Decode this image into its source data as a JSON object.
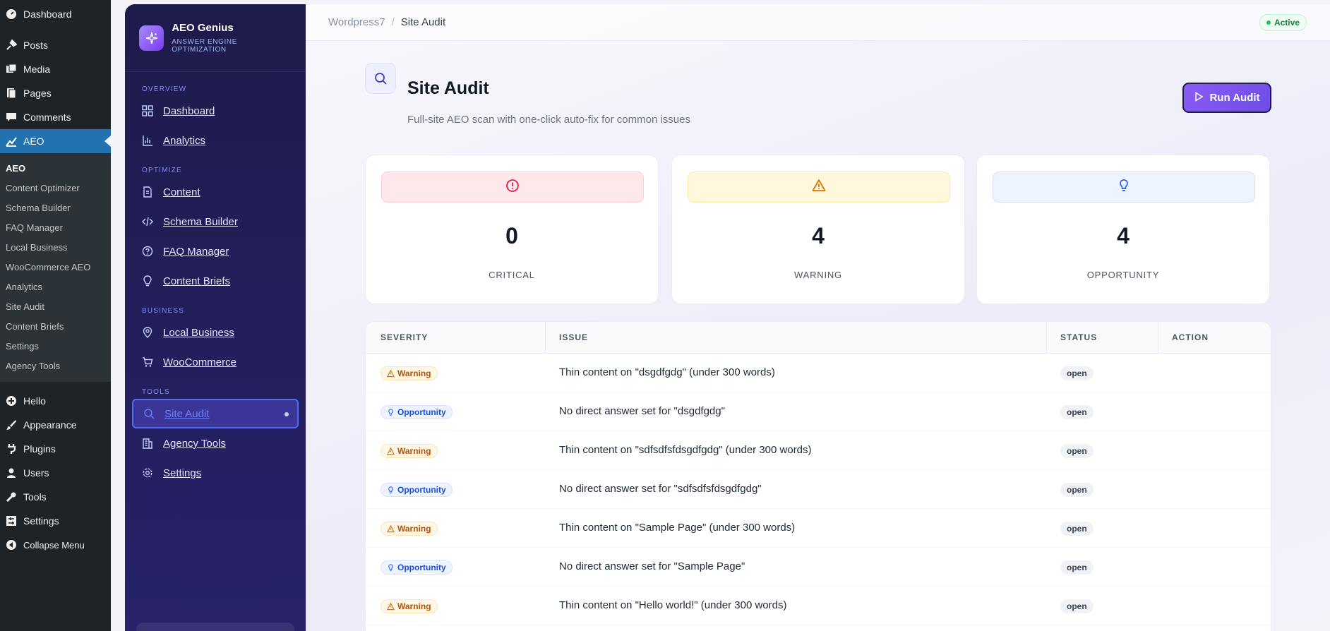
{
  "wp_menu": {
    "top": [
      {
        "label": "Dashboard",
        "icon": "dashboard-icon"
      },
      {
        "label": "Posts",
        "icon": "pin-icon"
      },
      {
        "label": "Media",
        "icon": "media-icon"
      },
      {
        "label": "Pages",
        "icon": "pages-icon"
      },
      {
        "label": "Comments",
        "icon": "comment-icon"
      },
      {
        "label": "AEO",
        "icon": "chart-icon"
      }
    ],
    "submenu": [
      "AEO",
      "Content Optimizer",
      "Schema Builder",
      "FAQ Manager",
      "Local Business",
      "WooCommerce AEO",
      "Analytics",
      "Site Audit",
      "Content Briefs",
      "Settings",
      "Agency Tools"
    ],
    "bottom": [
      {
        "label": "Hello",
        "icon": "plus-circle-icon"
      },
      {
        "label": "Appearance",
        "icon": "brush-icon"
      },
      {
        "label": "Plugins",
        "icon": "plug-icon"
      },
      {
        "label": "Users",
        "icon": "user-icon"
      },
      {
        "label": "Tools",
        "icon": "wrench-icon"
      },
      {
        "label": "Settings",
        "icon": "settings-icon"
      },
      {
        "label": "Collapse Menu",
        "icon": "collapse-icon"
      }
    ]
  },
  "plugin": {
    "name": "AEO Genius",
    "tagline": "ANSWER ENGINE OPTIMIZATION",
    "sections": {
      "overview": "OVERVIEW",
      "optimize": "OPTIMIZE",
      "business": "BUSINESS",
      "tools": "TOOLS"
    },
    "nav": {
      "dashboard": "Dashboard",
      "analytics": "Analytics",
      "content": "Content",
      "schema_builder": "Schema Builder",
      "faq_manager": "FAQ Manager",
      "content_briefs": "Content Briefs",
      "local_business": "Local Business",
      "woocommerce": "WooCommerce",
      "site_audit": "Site Audit",
      "agency_tools": "Agency Tools",
      "settings": "Settings"
    }
  },
  "breadcrumb": {
    "root": "Wordpress7",
    "separator": "/",
    "current": "Site Audit"
  },
  "status_badge": "Active",
  "page": {
    "title": "Site Audit",
    "subtitle": "Full-site AEO scan with one-click auto-fix for common issues",
    "run_button": "Run Audit"
  },
  "summary": [
    {
      "count": "0",
      "label": "CRITICAL",
      "color": "#e11d48"
    },
    {
      "count": "4",
      "label": "WARNING",
      "color": "#d97706"
    },
    {
      "count": "4",
      "label": "OPPORTUNITY",
      "color": "#2563eb"
    }
  ],
  "table": {
    "headers": {
      "severity": "SEVERITY",
      "issue": "ISSUE",
      "status": "STATUS",
      "action": "ACTION"
    },
    "rows": [
      {
        "severity": "Warning",
        "issue": "Thin content on \"dsgdfgdg\" (under 300 words)",
        "status": "open"
      },
      {
        "severity": "Opportunity",
        "issue": "No direct answer set for \"dsgdfgdg\"",
        "status": "open"
      },
      {
        "severity": "Warning",
        "issue": "Thin content on \"sdfsdfsfdsgdfgdg\" (under 300 words)",
        "status": "open"
      },
      {
        "severity": "Opportunity",
        "issue": "No direct answer set for \"sdfsdfsfdsgdfgdg\"",
        "status": "open"
      },
      {
        "severity": "Warning",
        "issue": "Thin content on \"Sample Page\" (under 300 words)",
        "status": "open"
      },
      {
        "severity": "Opportunity",
        "issue": "No direct answer set for \"Sample Page\"",
        "status": "open"
      },
      {
        "severity": "Warning",
        "issue": "Thin content on \"Hello world!\" (under 300 words)",
        "status": "open"
      }
    ]
  }
}
